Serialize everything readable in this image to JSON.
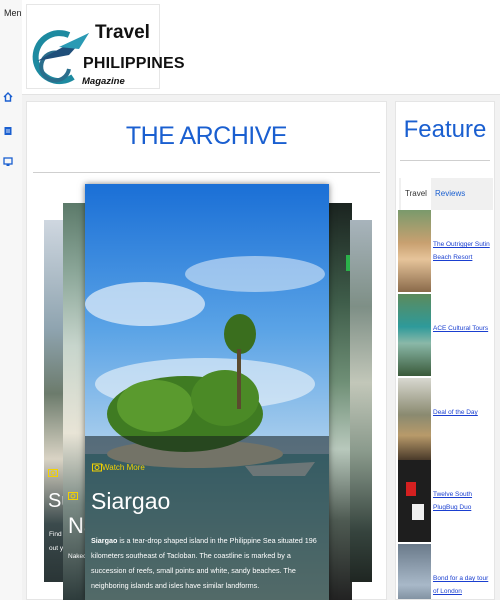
{
  "rail": {
    "menu_label": "Menu",
    "icons": [
      "home-icon",
      "document-icon",
      "monitor-icon"
    ]
  },
  "logo": {
    "line1": "Travel",
    "line2": "PHILIPPINES",
    "line3": "Magazine"
  },
  "archive": {
    "title": "THE ARCHIVE",
    "slides": [
      {
        "title": "Siargao",
        "watch_label": "Watch More",
        "desc_lead": "Siargao",
        "desc_rest": " is a tear-drop shaped island in the Philippine Sea situated 196 kilometers southeast of Tacloban. The coastline is marked by a succession of reefs, small points and white, sandy beaches. The neighboring islands and isles have similar landforms."
      },
      {
        "title_fragment": "Na",
        "desc_fragment": "Naked"
      },
      {
        "title_fragment": "Su",
        "desc_fragment": "Find th out yo"
      }
    ]
  },
  "feature": {
    "title": "Feature",
    "tabs": [
      "Travel",
      "Reviews"
    ],
    "items": [
      "The Outrigger Sutin Beach Resort",
      "ACE Cultural Tours",
      "Deal of the Day",
      "Twelve South PlugBug Duo",
      "Bond for a day tour of London"
    ]
  },
  "colors": {
    "accent_blue": "#1a5fd0",
    "watch_yellow": "#f3d200"
  }
}
